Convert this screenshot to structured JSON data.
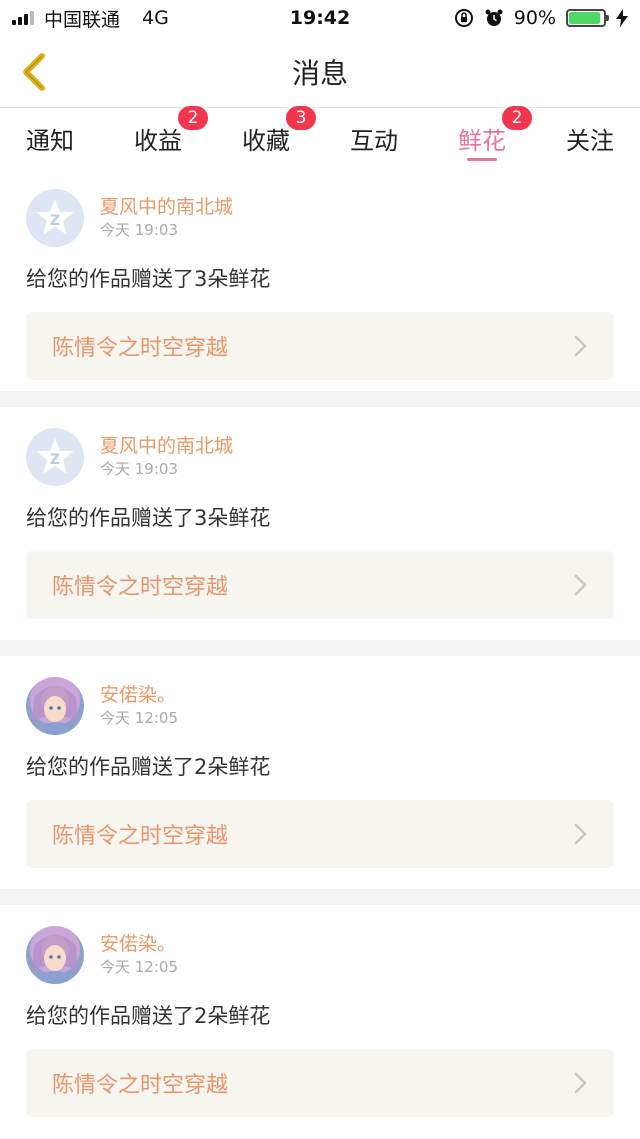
{
  "status_bar": {
    "carrier": "中国联通",
    "network": "4G",
    "time": "19:42",
    "battery": "90%"
  },
  "nav": {
    "title": "消息"
  },
  "tabs": [
    {
      "label": "通知",
      "badge": ""
    },
    {
      "label": "收益",
      "badge": "2"
    },
    {
      "label": "收藏",
      "badge": "3"
    },
    {
      "label": "互动",
      "badge": ""
    },
    {
      "label": "鲜花",
      "badge": "2",
      "active": true
    },
    {
      "label": "关注",
      "badge": ""
    }
  ],
  "messages": [
    {
      "username": "夏风中的南北城",
      "time": "今天 19:03",
      "text": "给您的作品赠送了3朵鲜花",
      "work": "陈情令之时空穿越",
      "avatar": "default"
    },
    {
      "username": "夏风中的南北城",
      "time": "今天 19:03",
      "text": "给您的作品赠送了3朵鲜花",
      "work": "陈情令之时空穿越",
      "avatar": "default"
    },
    {
      "username": "安偌染。",
      "time": "今天 12:05",
      "text": "给您的作品赠送了2朵鲜花",
      "work": "陈情令之时空穿越",
      "avatar": "anime"
    },
    {
      "username": "安偌染。",
      "time": "今天 12:05",
      "text": "给您的作品赠送了2朵鲜花",
      "work": "陈情令之时空穿越",
      "avatar": "anime"
    }
  ],
  "colors": {
    "accent": "#e8739c",
    "badge": "#f2364d",
    "username": "#e89a6a",
    "work_title": "#e8956a",
    "back_icon": "#e0b21a"
  }
}
